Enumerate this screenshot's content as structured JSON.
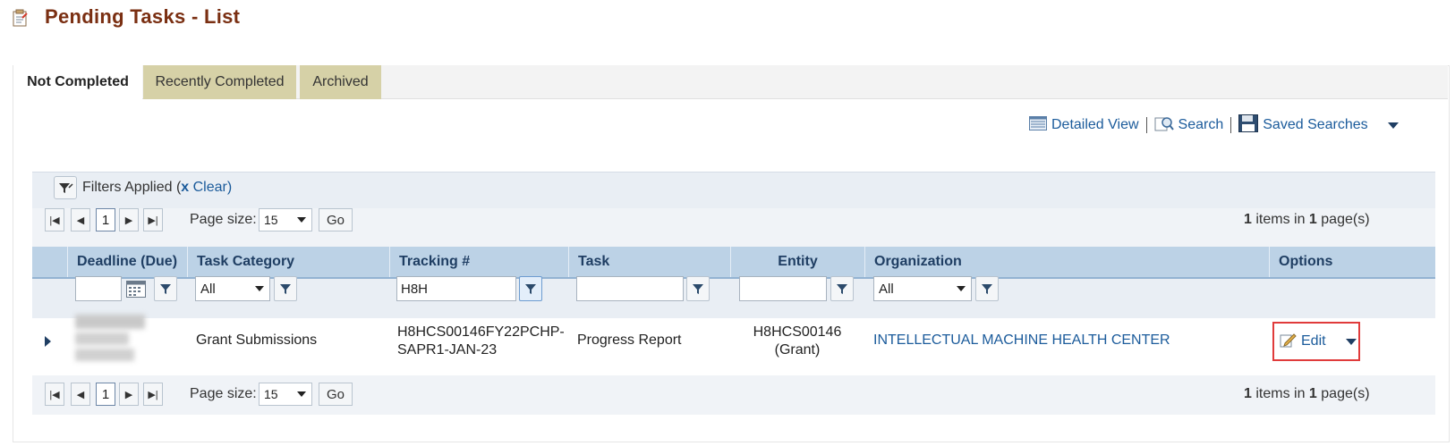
{
  "page": {
    "title": "Pending Tasks - List"
  },
  "tabs": [
    {
      "label": "Not Completed",
      "active": true
    },
    {
      "label": "Recently Completed",
      "active": false
    },
    {
      "label": "Archived",
      "active": false
    }
  ],
  "toolbar": {
    "detailed_view": "Detailed View",
    "search": "Search",
    "saved_searches": "Saved Searches"
  },
  "filters": {
    "label": "Filters Applied (",
    "clear_x": "x",
    "clear": " Clear",
    "close_paren": ")"
  },
  "pager": {
    "current_page": "1",
    "page_size_label": "Page size:",
    "page_size": "15",
    "go": "Go",
    "items_count": "1",
    "items_mid": " items in ",
    "pages_count": "1",
    "pages_suffix": " page(s)"
  },
  "columns": {
    "deadline": "Deadline (Due)",
    "task_category": "Task Category",
    "tracking": "Tracking #",
    "task": "Task",
    "entity": "Entity",
    "organization": "Organization",
    "options": "Options"
  },
  "column_filters": {
    "deadline": "",
    "task_category": "All",
    "tracking": "H8H",
    "task": "",
    "entity": "",
    "organization": "All"
  },
  "rows": [
    {
      "task_category": "Grant Submissions",
      "tracking_line1": "H8HCS00146FY22PCHP-",
      "tracking_line2": "SAPR1-JAN-23",
      "task": "Progress Report",
      "entity_line1": "H8HCS00146",
      "entity_line2": "(Grant)",
      "organization": "INTELLECTUAL MACHINE HEALTH CENTER",
      "edit": "Edit"
    }
  ],
  "colors": {
    "title": "#7a2f12",
    "link": "#1b5b9b",
    "tab_inactive": "#d6d1a7",
    "header_bg": "#bcd2e6",
    "highlight": "#e03b3b"
  }
}
